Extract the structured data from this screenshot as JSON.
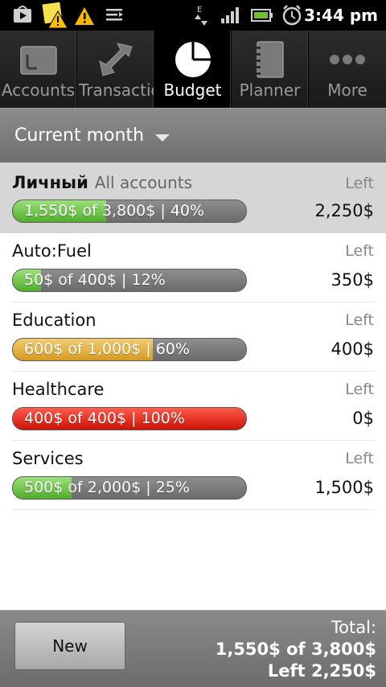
{
  "status_bar": {
    "time": "3:44 pm",
    "network_label": "E"
  },
  "tabs": [
    {
      "label": "Accounts",
      "icon": "wallet-icon",
      "active": false
    },
    {
      "label": "Transactions",
      "icon": "transfer-arrows-icon",
      "active": false
    },
    {
      "label": "Budget",
      "icon": "pie-chart-icon",
      "active": true
    },
    {
      "label": "Planner",
      "icon": "notebook-icon",
      "active": false
    },
    {
      "label": "More",
      "icon": "more-dots-icon",
      "active": false
    }
  ],
  "period": {
    "label": "Current month"
  },
  "summary": {
    "name": "Личный",
    "scope": "All accounts",
    "bar_text": "1,550$ of 3,800$ | 40%",
    "progress": 0.4,
    "color": "green",
    "left_label": "Left",
    "left_amount": "2,250$"
  },
  "budgets": [
    {
      "name": "Auto:Fuel",
      "bar_text": "50$ of 400$ | 12%",
      "progress": 0.12,
      "color": "green",
      "left_label": "Left",
      "left_amount": "350$"
    },
    {
      "name": "Education",
      "bar_text": "600$ of 1,000$ | 60%",
      "progress": 0.6,
      "color": "yellow",
      "left_label": "Left",
      "left_amount": "400$"
    },
    {
      "name": "Healthcare",
      "bar_text": "400$ of 400$ | 100%",
      "progress": 1.0,
      "color": "red",
      "left_label": "Left",
      "left_amount": "0$"
    },
    {
      "name": "Services",
      "bar_text": "500$ of 2,000$ | 25%",
      "progress": 0.25,
      "color": "green",
      "left_label": "Left",
      "left_amount": "1,500$"
    }
  ],
  "footer": {
    "new_button": "New",
    "total_label": "Total:",
    "total_amount": "1,550$ of 3,800$",
    "total_left": "Left 2,250$"
  },
  "colors": {
    "green": "#4fae2c",
    "yellow": "#d89a20",
    "red": "#cc1207",
    "header_gray": "#7d7d7d"
  }
}
